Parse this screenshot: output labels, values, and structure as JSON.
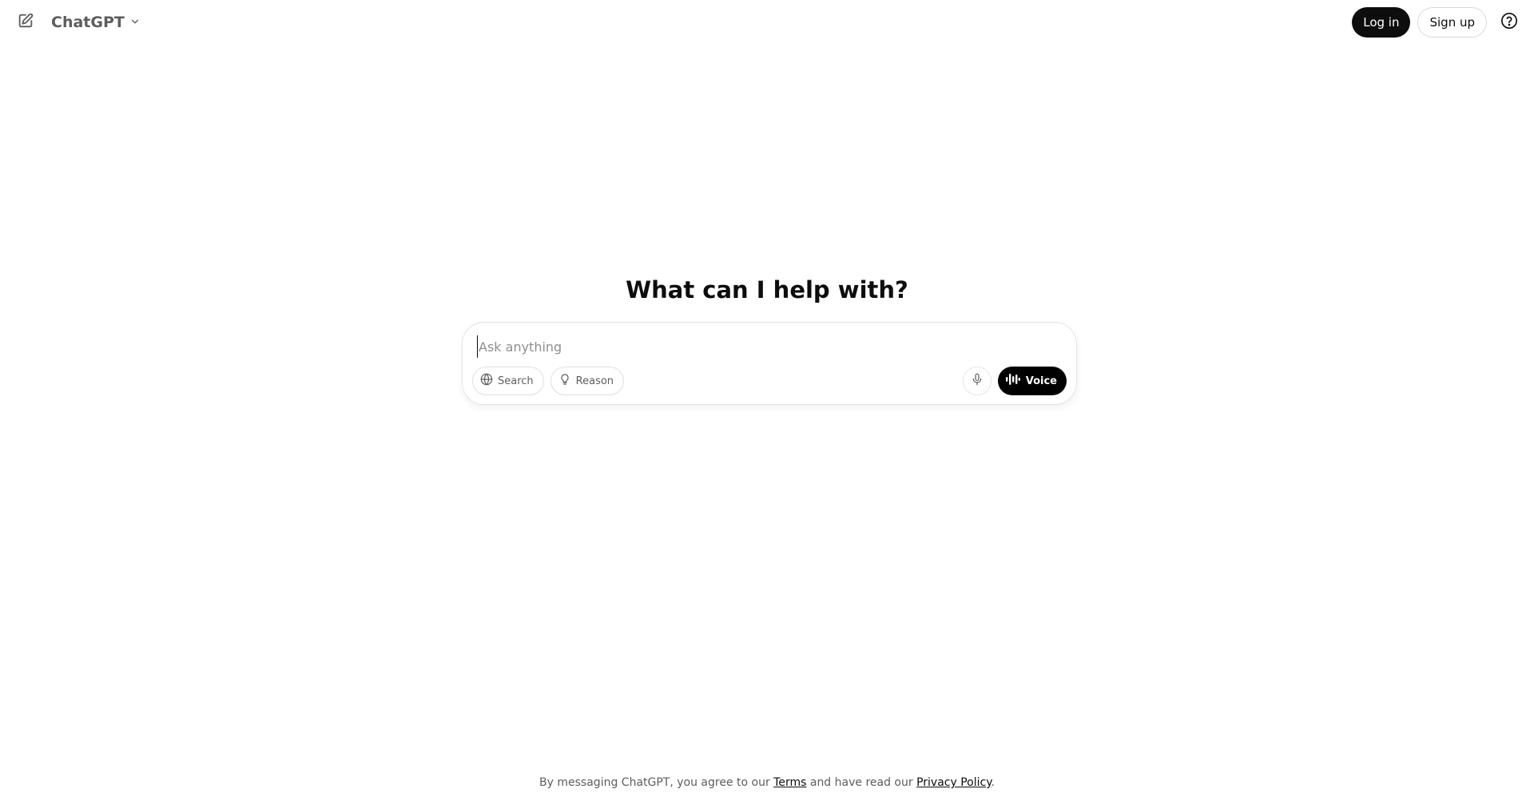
{
  "header": {
    "model_name": "ChatGPT",
    "login_label": "Log in",
    "signup_label": "Sign up"
  },
  "icons": {
    "new_chat": "edit-square-icon",
    "model_dropdown": "chevron-down-icon",
    "help": "question-circle-icon",
    "search": "globe-icon",
    "reason": "lightbulb-icon",
    "dictate": "microphone-icon",
    "voice": "waveform-icon"
  },
  "main": {
    "headline": "What can I help with?"
  },
  "composer": {
    "placeholder": "Ask anything",
    "value": "",
    "tools": [
      {
        "label": "Search"
      },
      {
        "label": "Reason"
      }
    ],
    "voice_label": "Voice"
  },
  "footer": {
    "prefix": "By messaging ChatGPT, you agree to our",
    "terms_link": "Terms",
    "middle": "and have read our",
    "privacy_link": "Privacy Policy",
    "suffix": "."
  },
  "colors": {
    "primary_button": "#0d0d0d",
    "text_primary": "#0d0d0d",
    "text_secondary": "#5d5d5d",
    "border": "#e3e3e3"
  }
}
